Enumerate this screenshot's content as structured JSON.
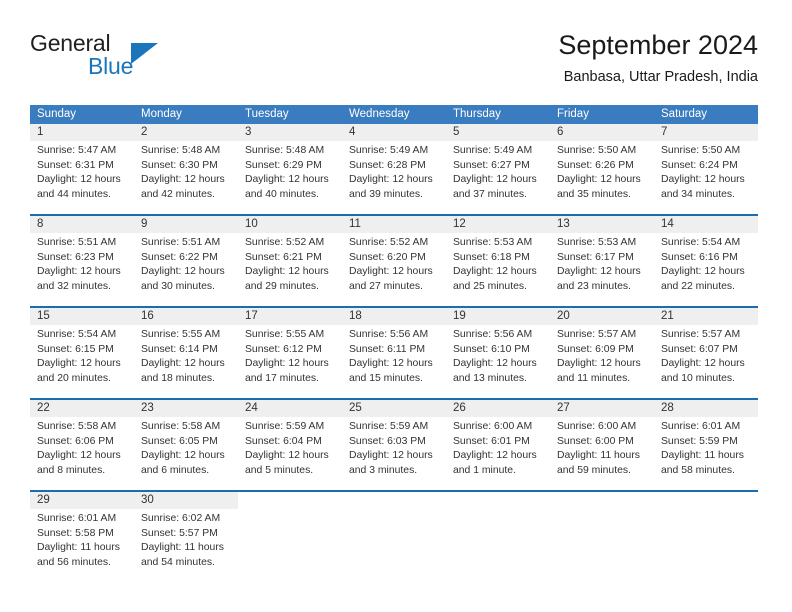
{
  "brand": {
    "word_one": "General",
    "word_two": "Blue",
    "icon": "triangle-logo"
  },
  "header": {
    "month_title": "September 2024",
    "location": "Banbasa, Uttar Pradesh, India"
  },
  "calendar": {
    "weekday_headers": [
      "Sunday",
      "Monday",
      "Tuesday",
      "Wednesday",
      "Thursday",
      "Friday",
      "Saturday"
    ],
    "accent_color": "#3a7cc0",
    "week_divider_color": "#1b6cb0",
    "daynum_band_color": "#efefef",
    "weeks": [
      {
        "days": [
          {
            "date": "1",
            "sunrise": "Sunrise: 5:47 AM",
            "sunset": "Sunset: 6:31 PM",
            "daylight_line1": "Daylight: 12 hours",
            "daylight_line2": "and 44 minutes."
          },
          {
            "date": "2",
            "sunrise": "Sunrise: 5:48 AM",
            "sunset": "Sunset: 6:30 PM",
            "daylight_line1": "Daylight: 12 hours",
            "daylight_line2": "and 42 minutes."
          },
          {
            "date": "3",
            "sunrise": "Sunrise: 5:48 AM",
            "sunset": "Sunset: 6:29 PM",
            "daylight_line1": "Daylight: 12 hours",
            "daylight_line2": "and 40 minutes."
          },
          {
            "date": "4",
            "sunrise": "Sunrise: 5:49 AM",
            "sunset": "Sunset: 6:28 PM",
            "daylight_line1": "Daylight: 12 hours",
            "daylight_line2": "and 39 minutes."
          },
          {
            "date": "5",
            "sunrise": "Sunrise: 5:49 AM",
            "sunset": "Sunset: 6:27 PM",
            "daylight_line1": "Daylight: 12 hours",
            "daylight_line2": "and 37 minutes."
          },
          {
            "date": "6",
            "sunrise": "Sunrise: 5:50 AM",
            "sunset": "Sunset: 6:26 PM",
            "daylight_line1": "Daylight: 12 hours",
            "daylight_line2": "and 35 minutes."
          },
          {
            "date": "7",
            "sunrise": "Sunrise: 5:50 AM",
            "sunset": "Sunset: 6:24 PM",
            "daylight_line1": "Daylight: 12 hours",
            "daylight_line2": "and 34 minutes."
          }
        ]
      },
      {
        "days": [
          {
            "date": "8",
            "sunrise": "Sunrise: 5:51 AM",
            "sunset": "Sunset: 6:23 PM",
            "daylight_line1": "Daylight: 12 hours",
            "daylight_line2": "and 32 minutes."
          },
          {
            "date": "9",
            "sunrise": "Sunrise: 5:51 AM",
            "sunset": "Sunset: 6:22 PM",
            "daylight_line1": "Daylight: 12 hours",
            "daylight_line2": "and 30 minutes."
          },
          {
            "date": "10",
            "sunrise": "Sunrise: 5:52 AM",
            "sunset": "Sunset: 6:21 PM",
            "daylight_line1": "Daylight: 12 hours",
            "daylight_line2": "and 29 minutes."
          },
          {
            "date": "11",
            "sunrise": "Sunrise: 5:52 AM",
            "sunset": "Sunset: 6:20 PM",
            "daylight_line1": "Daylight: 12 hours",
            "daylight_line2": "and 27 minutes."
          },
          {
            "date": "12",
            "sunrise": "Sunrise: 5:53 AM",
            "sunset": "Sunset: 6:18 PM",
            "daylight_line1": "Daylight: 12 hours",
            "daylight_line2": "and 25 minutes."
          },
          {
            "date": "13",
            "sunrise": "Sunrise: 5:53 AM",
            "sunset": "Sunset: 6:17 PM",
            "daylight_line1": "Daylight: 12 hours",
            "daylight_line2": "and 23 minutes."
          },
          {
            "date": "14",
            "sunrise": "Sunrise: 5:54 AM",
            "sunset": "Sunset: 6:16 PM",
            "daylight_line1": "Daylight: 12 hours",
            "daylight_line2": "and 22 minutes."
          }
        ]
      },
      {
        "days": [
          {
            "date": "15",
            "sunrise": "Sunrise: 5:54 AM",
            "sunset": "Sunset: 6:15 PM",
            "daylight_line1": "Daylight: 12 hours",
            "daylight_line2": "and 20 minutes."
          },
          {
            "date": "16",
            "sunrise": "Sunrise: 5:55 AM",
            "sunset": "Sunset: 6:14 PM",
            "daylight_line1": "Daylight: 12 hours",
            "daylight_line2": "and 18 minutes."
          },
          {
            "date": "17",
            "sunrise": "Sunrise: 5:55 AM",
            "sunset": "Sunset: 6:12 PM",
            "daylight_line1": "Daylight: 12 hours",
            "daylight_line2": "and 17 minutes."
          },
          {
            "date": "18",
            "sunrise": "Sunrise: 5:56 AM",
            "sunset": "Sunset: 6:11 PM",
            "daylight_line1": "Daylight: 12 hours",
            "daylight_line2": "and 15 minutes."
          },
          {
            "date": "19",
            "sunrise": "Sunrise: 5:56 AM",
            "sunset": "Sunset: 6:10 PM",
            "daylight_line1": "Daylight: 12 hours",
            "daylight_line2": "and 13 minutes."
          },
          {
            "date": "20",
            "sunrise": "Sunrise: 5:57 AM",
            "sunset": "Sunset: 6:09 PM",
            "daylight_line1": "Daylight: 12 hours",
            "daylight_line2": "and 11 minutes."
          },
          {
            "date": "21",
            "sunrise": "Sunrise: 5:57 AM",
            "sunset": "Sunset: 6:07 PM",
            "daylight_line1": "Daylight: 12 hours",
            "daylight_line2": "and 10 minutes."
          }
        ]
      },
      {
        "days": [
          {
            "date": "22",
            "sunrise": "Sunrise: 5:58 AM",
            "sunset": "Sunset: 6:06 PM",
            "daylight_line1": "Daylight: 12 hours",
            "daylight_line2": "and 8 minutes."
          },
          {
            "date": "23",
            "sunrise": "Sunrise: 5:58 AM",
            "sunset": "Sunset: 6:05 PM",
            "daylight_line1": "Daylight: 12 hours",
            "daylight_line2": "and 6 minutes."
          },
          {
            "date": "24",
            "sunrise": "Sunrise: 5:59 AM",
            "sunset": "Sunset: 6:04 PM",
            "daylight_line1": "Daylight: 12 hours",
            "daylight_line2": "and 5 minutes."
          },
          {
            "date": "25",
            "sunrise": "Sunrise: 5:59 AM",
            "sunset": "Sunset: 6:03 PM",
            "daylight_line1": "Daylight: 12 hours",
            "daylight_line2": "and 3 minutes."
          },
          {
            "date": "26",
            "sunrise": "Sunrise: 6:00 AM",
            "sunset": "Sunset: 6:01 PM",
            "daylight_line1": "Daylight: 12 hours",
            "daylight_line2": "and 1 minute."
          },
          {
            "date": "27",
            "sunrise": "Sunrise: 6:00 AM",
            "sunset": "Sunset: 6:00 PM",
            "daylight_line1": "Daylight: 11 hours",
            "daylight_line2": "and 59 minutes."
          },
          {
            "date": "28",
            "sunrise": "Sunrise: 6:01 AM",
            "sunset": "Sunset: 5:59 PM",
            "daylight_line1": "Daylight: 11 hours",
            "daylight_line2": "and 58 minutes."
          }
        ]
      },
      {
        "days": [
          {
            "date": "29",
            "sunrise": "Sunrise: 6:01 AM",
            "sunset": "Sunset: 5:58 PM",
            "daylight_line1": "Daylight: 11 hours",
            "daylight_line2": "and 56 minutes."
          },
          {
            "date": "30",
            "sunrise": "Sunrise: 6:02 AM",
            "sunset": "Sunset: 5:57 PM",
            "daylight_line1": "Daylight: 11 hours",
            "daylight_line2": "and 54 minutes."
          },
          {
            "date": "",
            "sunrise": "",
            "sunset": "",
            "daylight_line1": "",
            "daylight_line2": ""
          },
          {
            "date": "",
            "sunrise": "",
            "sunset": "",
            "daylight_line1": "",
            "daylight_line2": ""
          },
          {
            "date": "",
            "sunrise": "",
            "sunset": "",
            "daylight_line1": "",
            "daylight_line2": ""
          },
          {
            "date": "",
            "sunrise": "",
            "sunset": "",
            "daylight_line1": "",
            "daylight_line2": ""
          },
          {
            "date": "",
            "sunrise": "",
            "sunset": "",
            "daylight_line1": "",
            "daylight_line2": ""
          }
        ]
      }
    ]
  }
}
